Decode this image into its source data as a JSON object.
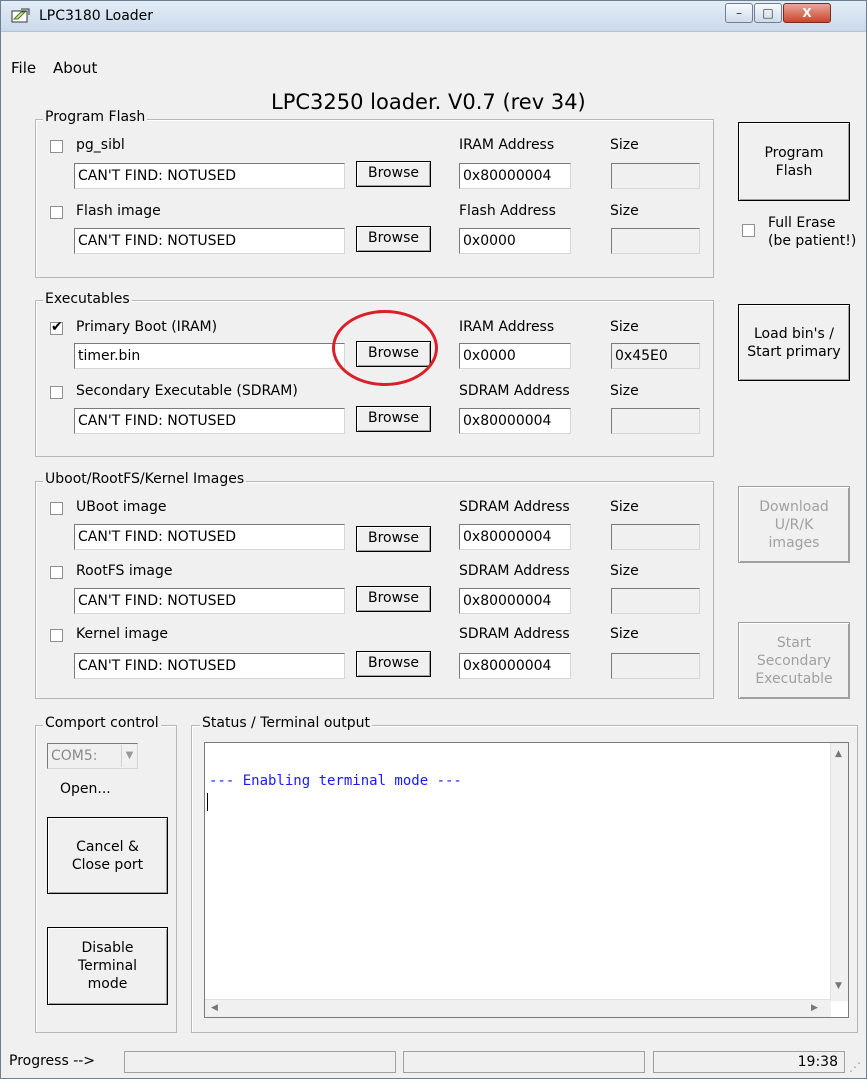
{
  "window": {
    "title": "LPC3180 Loader",
    "caption_buttons": {
      "minimize": "–",
      "maximize": "□",
      "close": "X"
    }
  },
  "menu": {
    "file": "File",
    "about": "About"
  },
  "main_title": "LPC3250 loader. V0.7 (rev 34)",
  "program_flash": {
    "group_label": "Program Flash",
    "rows": [
      {
        "checkbox_label": "pg_sibl",
        "checked": false,
        "path": "CAN'T FIND: NOTUSED",
        "browse": "Browse",
        "address_label": "IRAM Address",
        "address": "0x80000004",
        "size_label": "Size",
        "size": ""
      },
      {
        "checkbox_label": "Flash image",
        "checked": false,
        "path": "CAN'T FIND: NOTUSED",
        "browse": "Browse",
        "address_label": "Flash Address",
        "address": "0x0000",
        "size_label": "Size",
        "size": ""
      }
    ],
    "program_button": [
      "Program",
      "Flash"
    ],
    "full_erase_label": [
      "Full Erase",
      "(be patient!)"
    ]
  },
  "executables": {
    "group_label": "Executables",
    "rows": [
      {
        "checkbox_label": "Primary Boot (IRAM)",
        "checked": true,
        "path": "timer.bin",
        "browse": "Browse",
        "address_label": "IRAM Address",
        "address": "0x0000",
        "size_label": "Size",
        "size": "0x45E0"
      },
      {
        "checkbox_label": "Secondary Executable (SDRAM)",
        "checked": false,
        "path": "CAN'T FIND: NOTUSED",
        "browse": "Browse",
        "address_label": "SDRAM Address",
        "address": "0x80000004",
        "size_label": "Size",
        "size": ""
      }
    ],
    "load_button": [
      "Load bin's /",
      "Start primary"
    ]
  },
  "uboot": {
    "group_label": "Uboot/RootFS/Kernel Images",
    "rows": [
      {
        "checkbox_label": "UBoot image",
        "checked": false,
        "path": "CAN'T FIND: NOTUSED",
        "browse": "Browse",
        "address_label": "SDRAM Address",
        "address": "0x80000004",
        "size_label": "Size",
        "size": ""
      },
      {
        "checkbox_label": "RootFS image",
        "checked": false,
        "path": "CAN'T FIND: NOTUSED",
        "browse": "Browse",
        "address_label": "SDRAM Address",
        "address": "0x80000004",
        "size_label": "Size",
        "size": ""
      },
      {
        "checkbox_label": "Kernel image",
        "checked": false,
        "path": "CAN'T FIND: NOTUSED",
        "browse": "Browse",
        "address_label": "SDRAM Address",
        "address": "0x80000004",
        "size_label": "Size",
        "size": ""
      }
    ],
    "download_button": [
      "Download",
      "U/R/K",
      "images"
    ],
    "start_secondary_button": [
      "Start",
      "Secondary",
      "Executable"
    ]
  },
  "comport": {
    "group_label": "Comport control",
    "port": "COM5:",
    "state": "Open...",
    "cancel_button": [
      "Cancel &",
      "Close port"
    ],
    "disable_button": [
      "Disable",
      "Terminal",
      "mode"
    ]
  },
  "terminal": {
    "group_label": "Status / Terminal output",
    "text": "--- Enabling terminal mode ---"
  },
  "statusbar": {
    "progress_label": "Progress -->",
    "time": "19:38"
  },
  "colors": {
    "terminal_text": "#1a1aff",
    "highlight_circle": "#d9202a"
  }
}
